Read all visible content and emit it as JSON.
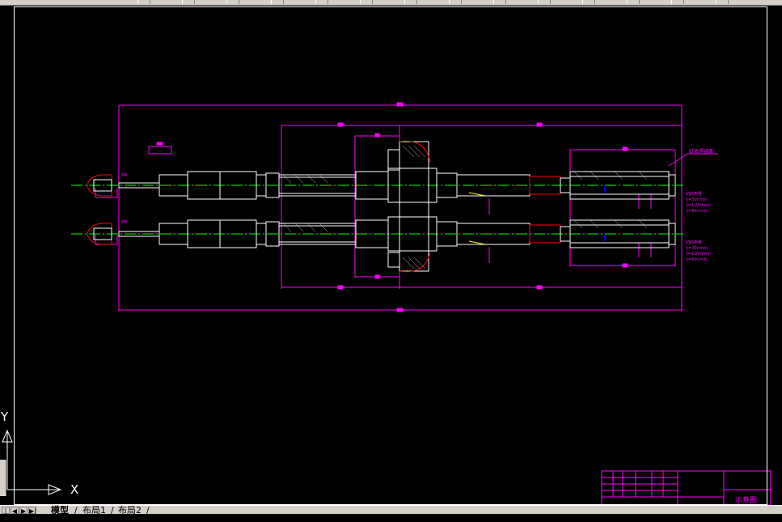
{
  "window": {
    "toolbar_button_count": 14
  },
  "drawing": {
    "background": "#000000",
    "frame_color": "#ffffff",
    "dimension_color": "#ff00ff",
    "centerline_color": "#00ff00",
    "part_color": "#ffffff",
    "hatch_color": "#ff0000",
    "leader_label": "缸体焊接面",
    "note_upper": [
      "切削用量",
      "n=30r/min",
      "s=1.25mm/r",
      "v=8m/min"
    ],
    "note_lower": [
      "切削用量",
      "n=30r/min",
      "s=1.25mm/r",
      "v=8m/min"
    ],
    "thread_label": "M6"
  },
  "ucs": {
    "x_label": "X",
    "y_label": "Y"
  },
  "title_block": {
    "title": "示意图"
  },
  "layout_tabs": {
    "model": "模型",
    "layout1": "布局1",
    "layout2": "布局2",
    "sep": "/"
  },
  "nav_arrows": [
    "◀",
    "|◀",
    "▶|",
    "▶"
  ]
}
